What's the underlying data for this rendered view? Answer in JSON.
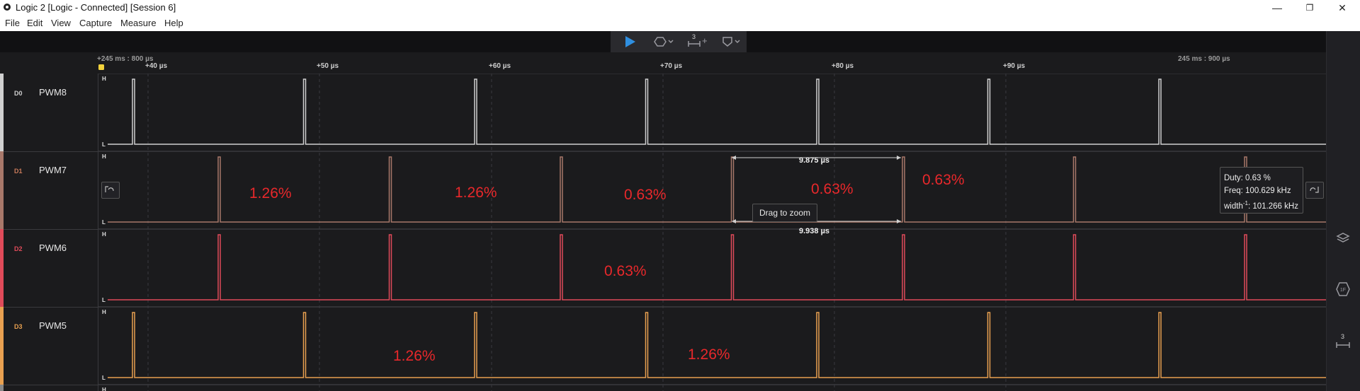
{
  "window": {
    "title": "Logic 2 [Logic - Connected] [Session 6]",
    "minimize": "—",
    "maximize": "❐",
    "close": "✕"
  },
  "menu": [
    "File",
    "Edit",
    "View",
    "Capture",
    "Measure",
    "Help"
  ],
  "toolbar": {
    "trigger_count": "3",
    "add": "+"
  },
  "ruler": {
    "start": "+245 ms : 800 µs",
    "end": "245 ms : 900 µs",
    "ticks": [
      "+40 µs",
      "+50 µs",
      "+60 µs",
      "+70 µs",
      "+80 µs",
      "+90 µs"
    ]
  },
  "channels": [
    {
      "id": "D0",
      "name": "PWM8",
      "color": "#d0d0d0",
      "high": "H",
      "low": "L"
    },
    {
      "id": "D1",
      "name": "PWM7",
      "color": "#a8786a",
      "high": "H",
      "low": "L"
    },
    {
      "id": "D2",
      "name": "PWM6",
      "color": "#e04b5a",
      "high": "H",
      "low": "L"
    },
    {
      "id": "D3",
      "name": "PWM5",
      "color": "#e8a050",
      "high": "H",
      "low": "L"
    },
    {
      "id": "",
      "name": "",
      "color": "#888888",
      "high": "H",
      "low": ""
    }
  ],
  "annotations": {
    "d1": [
      "1.26%",
      "1.26%",
      "0.63%",
      "0.63%",
      "0.63%"
    ],
    "d2": [
      "0.63%"
    ],
    "d3": [
      "1.26%",
      "1.26%"
    ]
  },
  "measurements": {
    "top_width": "9.875 µs",
    "bottom_width": "9.938 µs",
    "drag_tooltip": "Drag to zoom"
  },
  "measure_box": {
    "duty": "Duty: 0.63 %",
    "freq": "Freq: 100.629 kHz",
    "width_prefix": "width",
    "width_sup": "-1",
    "width_value": ": 101.266 kHz"
  },
  "right_panel": {
    "timing_count": "3"
  }
}
